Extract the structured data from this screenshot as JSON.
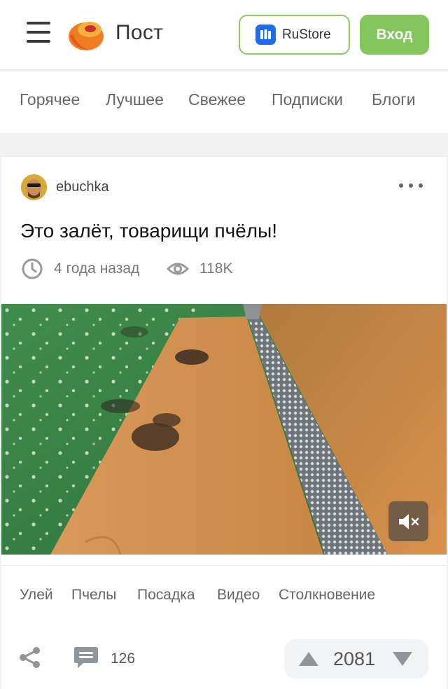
{
  "header": {
    "brand": "Пост",
    "rustore_label": "RuStore",
    "login_label": "Вход"
  },
  "tabs": [
    "Горячее",
    "Лучшее",
    "Свежее",
    "Подписки",
    "Блоги"
  ],
  "post": {
    "author": "ebuchka",
    "title": "Это залёт, товарищи пчёлы!",
    "time_ago": "4 года назад",
    "views": "118K",
    "tags": [
      "Улей",
      "Пчелы",
      "Посадка",
      "Видео",
      "Столкновение"
    ],
    "comments": "126",
    "rating": "2081"
  },
  "colors": {
    "accent_green": "#82c65d",
    "rustore_blue": "#1b6cf2"
  },
  "icons": [
    "menu-icon",
    "share-icon",
    "comment-icon",
    "clock-icon",
    "eye-icon",
    "more-icon",
    "mute-icon",
    "vote-up-icon",
    "vote-down-icon"
  ]
}
